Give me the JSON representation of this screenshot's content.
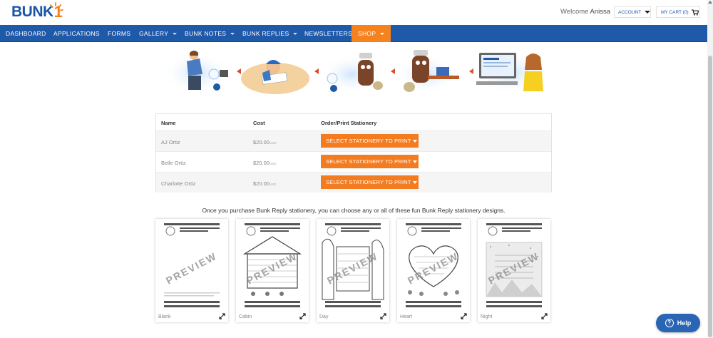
{
  "header": {
    "logo_text": "BUNK",
    "logo_number": "1",
    "welcome_prefix": "Welcome",
    "user_name": "Anissa",
    "account_label": "ACCOUNT",
    "cart_label": "MY CART (0)"
  },
  "nav": {
    "items": [
      {
        "label": "DASHBOARD",
        "dropdown": false
      },
      {
        "label": "APPLICATIONS",
        "dropdown": false
      },
      {
        "label": "FORMS",
        "dropdown": false
      },
      {
        "label": "GALLERY",
        "dropdown": true
      },
      {
        "label": "BUNK NOTES",
        "dropdown": true
      },
      {
        "label": "BUNK REPLIES",
        "dropdown": true
      },
      {
        "label": "NEWSLETTERS",
        "dropdown": false
      },
      {
        "label": "SHOP",
        "dropdown": true,
        "active": true
      }
    ]
  },
  "table": {
    "headers": {
      "name": "Name",
      "cost": "Cost",
      "order": "Order/Print Stationery"
    },
    "rows": [
      {
        "name": "AJ Ortiz",
        "cost": "$20.00",
        "currency": "USD",
        "button": "SELECT STATIONERY TO PRINT"
      },
      {
        "name": "Belle Ortiz",
        "cost": "$20.00",
        "currency": "USD",
        "button": "SELECT STATIONERY TO PRINT"
      },
      {
        "name": "Charlotte Ortiz",
        "cost": "$20.00",
        "currency": "USD",
        "button": "SELECT STATIONERY TO PRINT"
      }
    ]
  },
  "caption": "Once you purchase Bunk Reply stationery, you can choose any or all of these fun Bunk Reply stationery designs.",
  "designs": [
    {
      "label": "Blank",
      "watermark": "PREVIEW"
    },
    {
      "label": "Cabin",
      "watermark": "PREVIEW"
    },
    {
      "label": "Day",
      "watermark": "PREVIEW"
    },
    {
      "label": "Heart",
      "watermark": "PREVIEW"
    },
    {
      "label": "Night",
      "watermark": "PREVIEW"
    }
  ],
  "help": {
    "label": "Help"
  },
  "colors": {
    "nav_blue": "#1f5aa8",
    "accent_orange": "#f47c20",
    "logo_blue": "#1a55a8",
    "help_blue": "#2a64b4"
  }
}
